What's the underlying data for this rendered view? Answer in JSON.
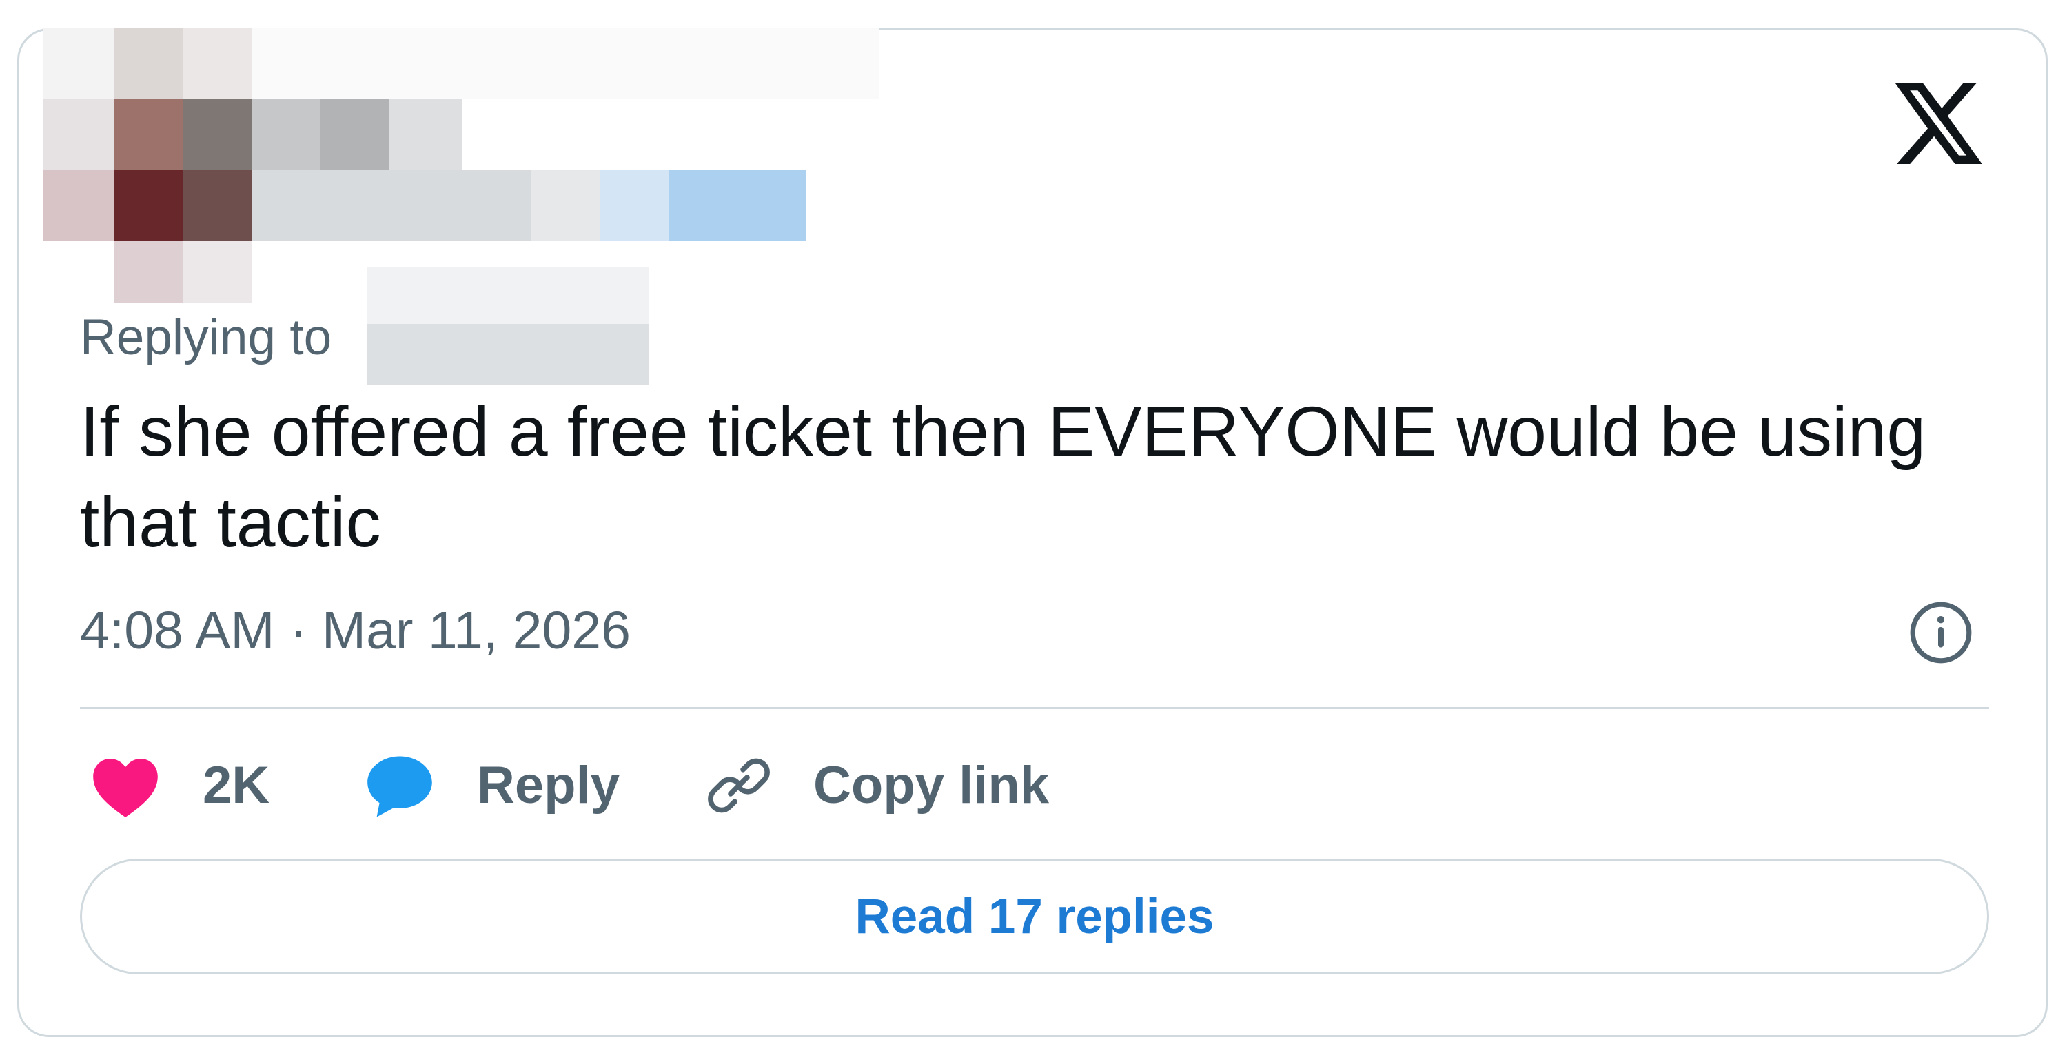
{
  "colors": {
    "border": "#cfd9de",
    "text_primary": "#0f1419",
    "text_secondary": "#536471",
    "like": "#f91880",
    "reply": "#1d9bf0",
    "link": "#1d7bd4"
  },
  "header": {
    "logo_icon": "x-logo-icon",
    "author_obscured": true
  },
  "tweet": {
    "replying_to_label": "Replying to",
    "text": "If she offered a free ticket then EVERYONE would be using that tactic",
    "timestamp": "4:08 AM · Mar 11, 2026",
    "info_icon": "info-icon"
  },
  "actions": {
    "like_count": "2K",
    "reply_label": "Reply",
    "copy_link_label": "Copy link"
  },
  "read_replies_label": "Read 17 replies"
}
